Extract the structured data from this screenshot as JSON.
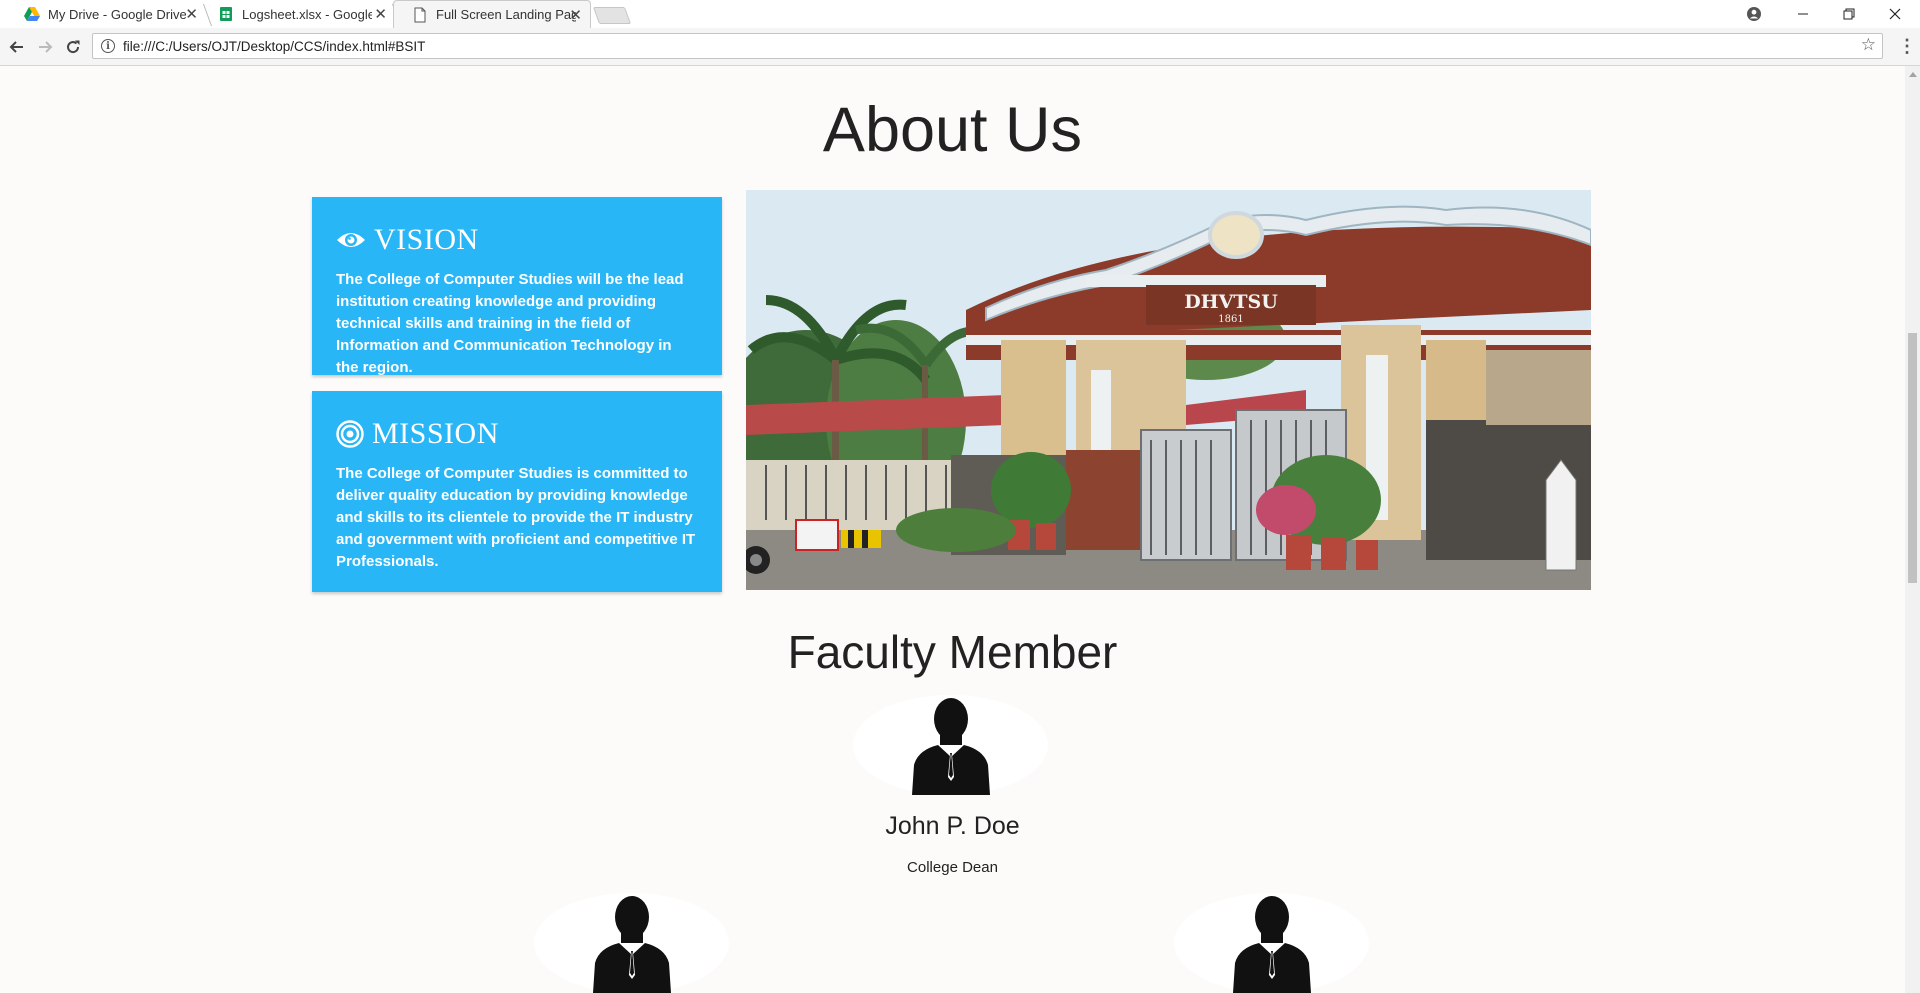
{
  "browser": {
    "tabs": [
      {
        "title": "My Drive - Google Drive",
        "active": false,
        "favicon": "google-drive-icon"
      },
      {
        "title": "Logsheet.xlsx - Google Sh",
        "active": false,
        "favicon": "google-sheets-icon"
      },
      {
        "title": "Full Screen Landing Page",
        "active": true,
        "favicon": "page-icon"
      }
    ],
    "url": "file:///C:/Users/OJT/Desktop/CCS/index.html#BSIT"
  },
  "about": {
    "title": "About Us",
    "vision": {
      "heading": "VISION",
      "icon": "eye-icon",
      "text": "The College of Computer Studies will be the lead institution creating knowledge and providing technical skills and training in the field of Information and Communication Technology in the region."
    },
    "mission": {
      "heading": "MISSION",
      "icon": "target-icon",
      "text": "The College of Computer Studies is committed to deliver quality education by providing knowledge and skills to its clientele to provide the IT industry and government with proficient and competitive IT Professionals."
    },
    "image": {
      "sign_text": "DHVTSU",
      "sign_year": "1861"
    }
  },
  "faculty": {
    "title": "Faculty Member",
    "dean": {
      "name": "John P. Doe",
      "role": "College Dean"
    }
  },
  "colors": {
    "card_blue": "#29b6f6",
    "page_bg": "#fcfbf9"
  }
}
